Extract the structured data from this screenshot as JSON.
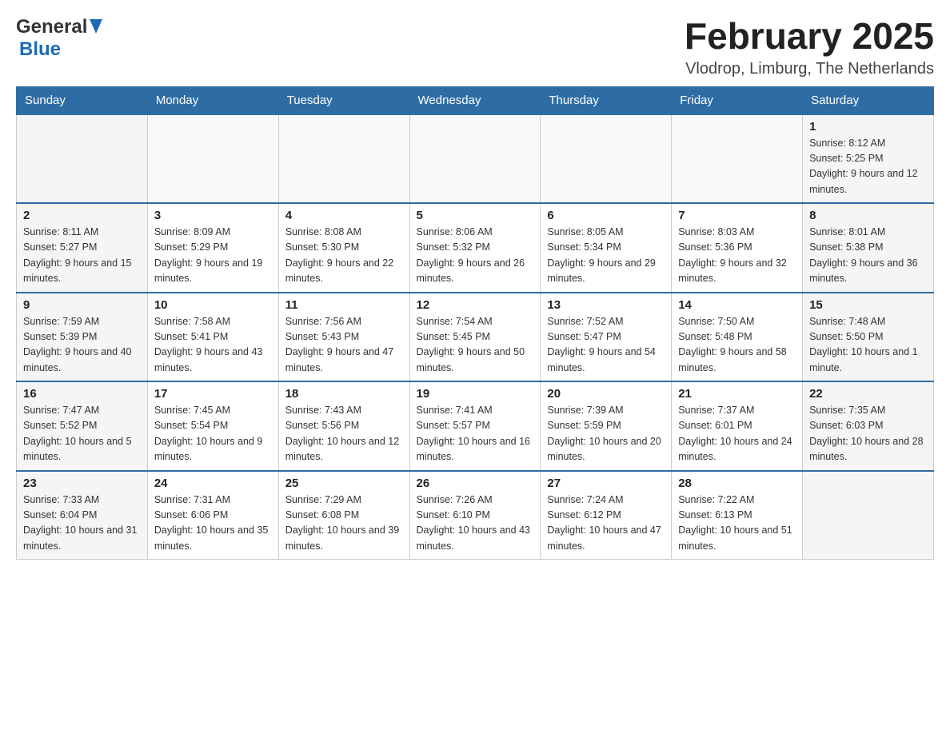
{
  "header": {
    "logo_general": "General",
    "logo_blue": "Blue",
    "month_title": "February 2025",
    "location": "Vlodrop, Limburg, The Netherlands"
  },
  "days_of_week": [
    "Sunday",
    "Monday",
    "Tuesday",
    "Wednesday",
    "Thursday",
    "Friday",
    "Saturday"
  ],
  "weeks": [
    {
      "days": [
        {
          "number": "",
          "info": ""
        },
        {
          "number": "",
          "info": ""
        },
        {
          "number": "",
          "info": ""
        },
        {
          "number": "",
          "info": ""
        },
        {
          "number": "",
          "info": ""
        },
        {
          "number": "",
          "info": ""
        },
        {
          "number": "1",
          "info": "Sunrise: 8:12 AM\nSunset: 5:25 PM\nDaylight: 9 hours and 12 minutes."
        }
      ]
    },
    {
      "days": [
        {
          "number": "2",
          "info": "Sunrise: 8:11 AM\nSunset: 5:27 PM\nDaylight: 9 hours and 15 minutes."
        },
        {
          "number": "3",
          "info": "Sunrise: 8:09 AM\nSunset: 5:29 PM\nDaylight: 9 hours and 19 minutes."
        },
        {
          "number": "4",
          "info": "Sunrise: 8:08 AM\nSunset: 5:30 PM\nDaylight: 9 hours and 22 minutes."
        },
        {
          "number": "5",
          "info": "Sunrise: 8:06 AM\nSunset: 5:32 PM\nDaylight: 9 hours and 26 minutes."
        },
        {
          "number": "6",
          "info": "Sunrise: 8:05 AM\nSunset: 5:34 PM\nDaylight: 9 hours and 29 minutes."
        },
        {
          "number": "7",
          "info": "Sunrise: 8:03 AM\nSunset: 5:36 PM\nDaylight: 9 hours and 32 minutes."
        },
        {
          "number": "8",
          "info": "Sunrise: 8:01 AM\nSunset: 5:38 PM\nDaylight: 9 hours and 36 minutes."
        }
      ]
    },
    {
      "days": [
        {
          "number": "9",
          "info": "Sunrise: 7:59 AM\nSunset: 5:39 PM\nDaylight: 9 hours and 40 minutes."
        },
        {
          "number": "10",
          "info": "Sunrise: 7:58 AM\nSunset: 5:41 PM\nDaylight: 9 hours and 43 minutes."
        },
        {
          "number": "11",
          "info": "Sunrise: 7:56 AM\nSunset: 5:43 PM\nDaylight: 9 hours and 47 minutes."
        },
        {
          "number": "12",
          "info": "Sunrise: 7:54 AM\nSunset: 5:45 PM\nDaylight: 9 hours and 50 minutes."
        },
        {
          "number": "13",
          "info": "Sunrise: 7:52 AM\nSunset: 5:47 PM\nDaylight: 9 hours and 54 minutes."
        },
        {
          "number": "14",
          "info": "Sunrise: 7:50 AM\nSunset: 5:48 PM\nDaylight: 9 hours and 58 minutes."
        },
        {
          "number": "15",
          "info": "Sunrise: 7:48 AM\nSunset: 5:50 PM\nDaylight: 10 hours and 1 minute."
        }
      ]
    },
    {
      "days": [
        {
          "number": "16",
          "info": "Sunrise: 7:47 AM\nSunset: 5:52 PM\nDaylight: 10 hours and 5 minutes."
        },
        {
          "number": "17",
          "info": "Sunrise: 7:45 AM\nSunset: 5:54 PM\nDaylight: 10 hours and 9 minutes."
        },
        {
          "number": "18",
          "info": "Sunrise: 7:43 AM\nSunset: 5:56 PM\nDaylight: 10 hours and 12 minutes."
        },
        {
          "number": "19",
          "info": "Sunrise: 7:41 AM\nSunset: 5:57 PM\nDaylight: 10 hours and 16 minutes."
        },
        {
          "number": "20",
          "info": "Sunrise: 7:39 AM\nSunset: 5:59 PM\nDaylight: 10 hours and 20 minutes."
        },
        {
          "number": "21",
          "info": "Sunrise: 7:37 AM\nSunset: 6:01 PM\nDaylight: 10 hours and 24 minutes."
        },
        {
          "number": "22",
          "info": "Sunrise: 7:35 AM\nSunset: 6:03 PM\nDaylight: 10 hours and 28 minutes."
        }
      ]
    },
    {
      "days": [
        {
          "number": "23",
          "info": "Sunrise: 7:33 AM\nSunset: 6:04 PM\nDaylight: 10 hours and 31 minutes."
        },
        {
          "number": "24",
          "info": "Sunrise: 7:31 AM\nSunset: 6:06 PM\nDaylight: 10 hours and 35 minutes."
        },
        {
          "number": "25",
          "info": "Sunrise: 7:29 AM\nSunset: 6:08 PM\nDaylight: 10 hours and 39 minutes."
        },
        {
          "number": "26",
          "info": "Sunrise: 7:26 AM\nSunset: 6:10 PM\nDaylight: 10 hours and 43 minutes."
        },
        {
          "number": "27",
          "info": "Sunrise: 7:24 AM\nSunset: 6:12 PM\nDaylight: 10 hours and 47 minutes."
        },
        {
          "number": "28",
          "info": "Sunrise: 7:22 AM\nSunset: 6:13 PM\nDaylight: 10 hours and 51 minutes."
        },
        {
          "number": "",
          "info": ""
        }
      ]
    }
  ]
}
